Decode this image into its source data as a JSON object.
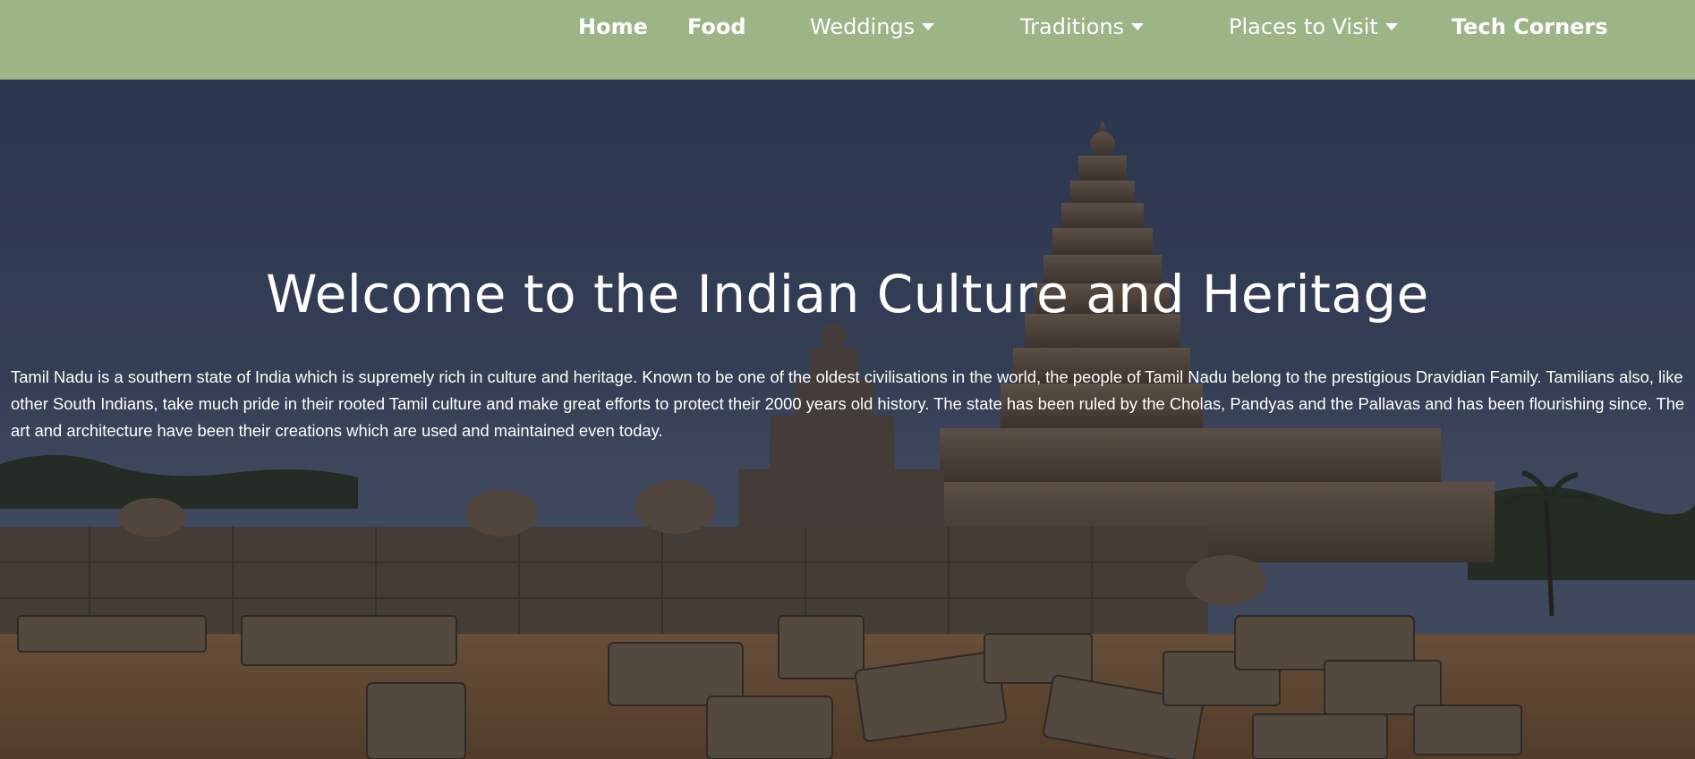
{
  "nav": {
    "items": [
      {
        "label": "Home",
        "dropdown": false
      },
      {
        "label": "Food",
        "dropdown": false
      },
      {
        "label": "Weddings",
        "dropdown": true
      },
      {
        "label": "Traditions",
        "dropdown": true
      },
      {
        "label": "Places to Visit",
        "dropdown": true
      },
      {
        "label": "Tech Corners",
        "dropdown": false
      }
    ],
    "background": "#9db487"
  },
  "hero": {
    "title": "Welcome to the Indian Culture and Heritage",
    "description": "Tamil Nadu is a southern state of India which is supremely rich in culture and heritage. Known to be one of the oldest civilisations in the world, the people of Tamil Nadu belong to the prestigious Dravidian Family. Tamilians also, like other South Indians, take much pride in their rooted Tamil culture and make great efforts to protect their 2000 years old history. The state has been ruled by the Cholas, Pandyas and the Pallavas and has been flourishing since. The art and architecture have been their creations which are used and maintained even today."
  }
}
